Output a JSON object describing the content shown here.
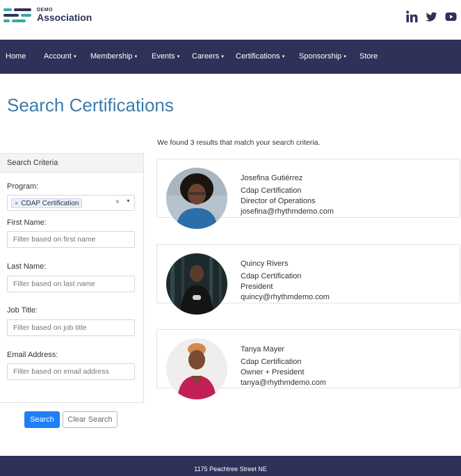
{
  "brand": {
    "small": "DEMO",
    "name": "Association"
  },
  "social": [
    "linkedin-icon",
    "twitter-icon",
    "youtube-icon"
  ],
  "nav": {
    "home": "Home",
    "account": "Account",
    "membership": "Membership",
    "events": "Events",
    "careers": "Careers",
    "certifications": "Certifications",
    "sponsorship": "Sponsorship",
    "store": "Store"
  },
  "page": {
    "title": "Search Certifications"
  },
  "criteria": {
    "heading": "Search Criteria",
    "program_label": "Program:",
    "program_selected": "CDAP Certification",
    "first_name_label": "First Name:",
    "first_name_placeholder": "Filter based on first name",
    "last_name_label": "Last Name:",
    "last_name_placeholder": "Filter based on last name",
    "job_title_label": "Job Title:",
    "job_title_placeholder": "Filter based on job title",
    "email_label": "Email Address:",
    "email_placeholder": "Filter based on email address",
    "search_button": "Search",
    "clear_button": "Clear Search"
  },
  "results": {
    "summary": "We found 3 results that match your search criteria.",
    "items": [
      {
        "name": "Josefina Gutiérrez",
        "certification": "Cdap Certification",
        "title": "Director of Operations",
        "email": "josefina@rhythmdemo.com"
      },
      {
        "name": "Quincy Rivers",
        "certification": "Cdap Certification",
        "title": "President",
        "email": "quincy@rhythmdemo.com"
      },
      {
        "name": "Tanya Mayer",
        "certification": "Cdap Certification",
        "title": "Owner + President",
        "email": "tanya@rhythmdemo.com"
      }
    ]
  },
  "footer": {
    "address": "1175 Peachtree Street NE"
  },
  "colors": {
    "navy": "#2e3258",
    "title_blue": "#3d7bab",
    "teal": "#3aa7a3",
    "button_blue": "#1e7ff6"
  }
}
